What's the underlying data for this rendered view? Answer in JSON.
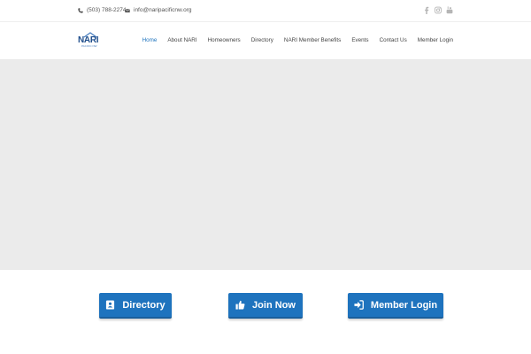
{
  "topbar": {
    "phone": "(503) 788-2274",
    "email": "info@naripacificnw.org",
    "social": [
      "facebook-icon",
      "instagram-icon",
      "youtube-icon"
    ]
  },
  "logo": {
    "text": "NARI",
    "sub": "PACIFIC NW"
  },
  "nav": {
    "items": [
      {
        "label": "Home",
        "active": true
      },
      {
        "label": "About NARI"
      },
      {
        "label": "Homeowners"
      },
      {
        "label": "Directory"
      },
      {
        "label": "NARI Member Benefits"
      },
      {
        "label": "Events"
      },
      {
        "label": "Contact Us"
      },
      {
        "label": "Member Login"
      }
    ]
  },
  "actions": {
    "directory": "Directory",
    "join": "Join Now",
    "login": "Member Login"
  },
  "colors": {
    "accent": "#1e73be",
    "hero": "#ebebeb"
  }
}
